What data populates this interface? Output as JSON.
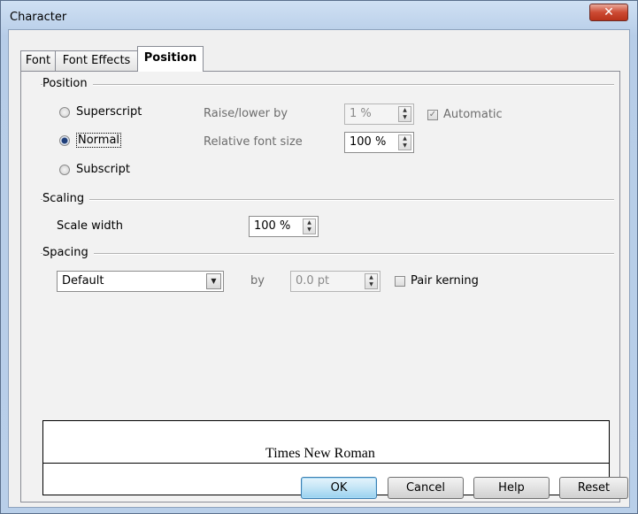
{
  "window": {
    "title": "Character"
  },
  "tabs": [
    {
      "label": "Font"
    },
    {
      "label": "Font Effects"
    },
    {
      "label": "Position"
    }
  ],
  "position_group": {
    "label": "Position",
    "radios": [
      {
        "label": "Superscript",
        "selected": false
      },
      {
        "label": "Normal",
        "selected": true
      },
      {
        "label": "Subscript",
        "selected": false
      }
    ],
    "raise_lower": {
      "label": "Raise/lower by",
      "value": "1 %"
    },
    "automatic": {
      "label": "Automatic",
      "checked": true
    },
    "relative_size": {
      "label": "Relative font size",
      "value": "100 %"
    }
  },
  "scaling_group": {
    "label": "Scaling",
    "scale_width": {
      "label": "Scale width",
      "value": "100 %"
    }
  },
  "spacing_group": {
    "label": "Spacing",
    "spacing_select": {
      "value": "Default"
    },
    "by": {
      "label": "by",
      "value": "0.0 pt"
    },
    "pair_kerning": {
      "label": "Pair kerning",
      "checked": false
    }
  },
  "preview": {
    "text": "Times New Roman"
  },
  "buttons": {
    "ok": "OK",
    "cancel": "Cancel",
    "help": "Help",
    "reset": "Reset"
  },
  "colors": {
    "title_gradient": "#b9cfe9",
    "close_button": "#cc4a33",
    "default_button": "#98d1ef"
  }
}
